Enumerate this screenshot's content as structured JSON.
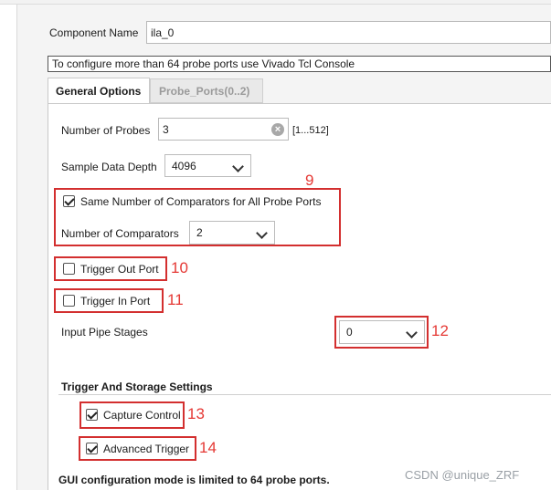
{
  "component": {
    "label": "Component Name",
    "value": "ila_0"
  },
  "info_text": "To configure more than 64 probe ports use Vivado Tcl Console",
  "tabs": [
    {
      "label": "General Options",
      "active": true
    },
    {
      "label": "Probe_Ports(0..2)",
      "active": false
    }
  ],
  "general": {
    "num_probes": {
      "label": "Number of Probes",
      "value": "3",
      "range": "[1...512]"
    },
    "sample_depth": {
      "label": "Sample Data Depth",
      "value": "4096"
    },
    "same_comparators": {
      "label": "Same Number of Comparators for All Probe Ports",
      "checked": true
    },
    "num_comparators": {
      "label": "Number of Comparators",
      "value": "2"
    },
    "trigger_out": {
      "label": "Trigger Out Port",
      "checked": false
    },
    "trigger_in": {
      "label": "Trigger In Port",
      "checked": false
    },
    "pipe_stages": {
      "label": "Input Pipe Stages",
      "value": "0"
    },
    "trigger_storage": {
      "heading": "Trigger And Storage Settings",
      "capture_control": {
        "label": "Capture Control",
        "checked": true
      },
      "advanced_trigger": {
        "label": "Advanced Trigger",
        "checked": true
      }
    },
    "footer_note": "GUI configuration mode is limited to 64 probe ports."
  },
  "annotations": [
    "9",
    "10",
    "11",
    "12",
    "13",
    "14"
  ],
  "watermark": "CSDN @unique_ZRF",
  "colors": {
    "highlight": "#d32f2f",
    "annotation": "#e53935"
  }
}
